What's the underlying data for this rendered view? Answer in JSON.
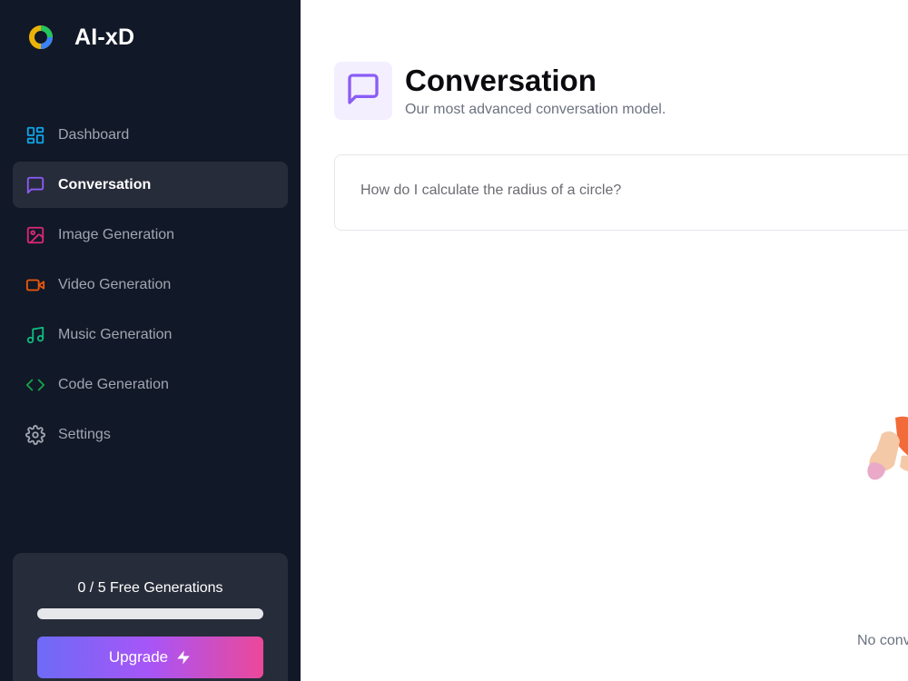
{
  "app": {
    "name": "AI-xD"
  },
  "sidebar": {
    "items": [
      {
        "label": "Dashboard",
        "icon": "dashboard-grid-icon",
        "color": "#0ea5e9",
        "active": false
      },
      {
        "label": "Conversation",
        "icon": "message-square-icon",
        "color": "#8b5cf6",
        "active": true
      },
      {
        "label": "Image Generation",
        "icon": "image-icon",
        "color": "#db2777",
        "active": false
      },
      {
        "label": "Video Generation",
        "icon": "video-icon",
        "color": "#ea580c",
        "active": false
      },
      {
        "label": "Music Generation",
        "icon": "music-note-icon",
        "color": "#10b981",
        "active": false
      },
      {
        "label": "Code Generation",
        "icon": "code-brackets-icon",
        "color": "#16a34a",
        "active": false
      },
      {
        "label": "Settings",
        "icon": "gear-icon",
        "color": "#a1a6b2",
        "active": false
      }
    ],
    "usage": {
      "count_text": "0 / 5 Free Generations",
      "progress_fraction": 0
    },
    "upgrade_label": "Upgrade"
  },
  "main": {
    "title": "Conversation",
    "subtitle": "Our most advanced conversation model.",
    "prompt": {
      "placeholder": "How do I calculate the radius of a circle?",
      "value": ""
    },
    "empty_state_text": "No conv"
  },
  "colors": {
    "sidebar_bg": "#111827",
    "active_item_bg": "#272c3a",
    "accent_violet": "#8b5cf6",
    "upgrade_gradient": [
      "#6d6bf7",
      "#a855f7",
      "#ec4899"
    ]
  }
}
